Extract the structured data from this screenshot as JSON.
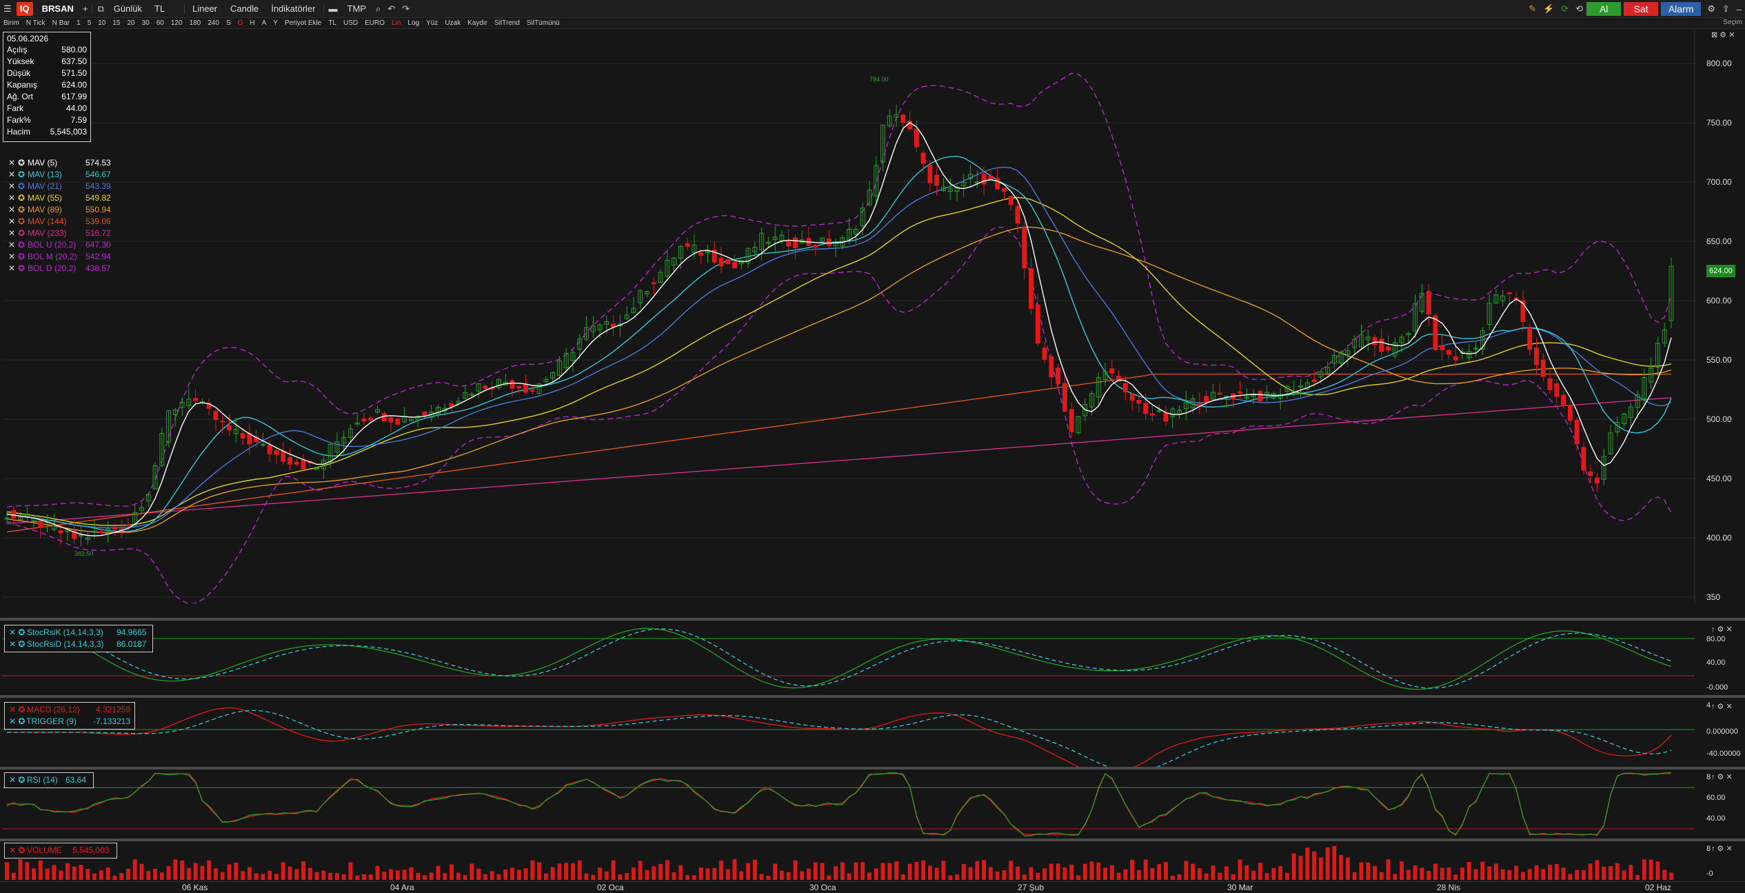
{
  "toolbar": {
    "symbol": "BRSAN",
    "plus": "+",
    "period": "Günlük",
    "currency": "TL",
    "scale": "Lineer",
    "chart_type": "Candle",
    "indicators": "İndikatörler",
    "tmp": "TMP",
    "buy": "Al",
    "sell": "Sat",
    "alarm": "Alarm"
  },
  "toolbar2": {
    "items": [
      "Birim",
      "N Tick",
      "N Bar",
      "1",
      "5",
      "10",
      "15",
      "20",
      "30",
      "60",
      "120",
      "180",
      "240",
      "S",
      "G",
      "H",
      "A",
      "Y",
      "Periyot Ekle",
      "TL",
      "USD",
      "EURO",
      "Lin",
      "Log",
      "Yüz",
      "Uzak",
      "Kaydır",
      "SilTrend",
      "SilTümünü"
    ],
    "active": [
      "G",
      "Lin"
    ],
    "right": "Seçim"
  },
  "info": {
    "date": "05.06.2026",
    "rows": [
      {
        "label": "Açılış",
        "value": "580.00"
      },
      {
        "label": "Yüksek",
        "value": "637.50"
      },
      {
        "label": "Düşük",
        "value": "571.50"
      },
      {
        "label": "Kapanış",
        "value": "624.00"
      },
      {
        "label": "Ağ. Ort",
        "value": "617.99"
      },
      {
        "label": "Fark",
        "value": "44.00"
      },
      {
        "label": "Fark%",
        "value": "7.59"
      },
      {
        "label": "Hacim",
        "value": "5,545,003"
      }
    ]
  },
  "legend": [
    {
      "name": "MAV (5)",
      "value": "574.53",
      "color": "#ffffff"
    },
    {
      "name": "MAV (13)",
      "value": "546.67",
      "color": "#33c6d6"
    },
    {
      "name": "MAV (21)",
      "value": "543.39",
      "color": "#4a78d8"
    },
    {
      "name": "MAV (55)",
      "value": "549.82",
      "color": "#e0d026"
    },
    {
      "name": "MAV (89)",
      "value": "550.94",
      "color": "#e09a26"
    },
    {
      "name": "MAV (144)",
      "value": "539.06",
      "color": "#d8531e"
    },
    {
      "name": "MAV (233)",
      "value": "516.72",
      "color": "#cf2f8c"
    },
    {
      "name": "BOL U (20,2)",
      "value": "647.30",
      "color": "#b526c8"
    },
    {
      "name": "BOL M (20,2)",
      "value": "542.94",
      "color": "#b526c8"
    },
    {
      "name": "BOL D (20,2)",
      "value": "438.57",
      "color": "#b526c8"
    }
  ],
  "price_axis": [
    "800.00",
    "750.00",
    "700.00",
    "650.00",
    "600.00",
    "550.00",
    "500.00",
    "450.00",
    "400.00",
    "350"
  ],
  "last_price": "624.00",
  "annotations": {
    "high": "784.00",
    "low": "383.50"
  },
  "stoch": {
    "k_name": "StocRsiK (14,14,3,3)",
    "k_value": "94.9665",
    "d_name": "StocRsiD (14,14,3,3)",
    "d_value": "86.0187",
    "axis": [
      "80.00",
      "40.00",
      "-0.000"
    ]
  },
  "macd": {
    "macd_name": "MACD (26,12)",
    "macd_value": "4.321259",
    "trig_name": "TRIGGER (9)",
    "trig_value": "-7.133213",
    "axis": [
      "4",
      "0.000000",
      "-40.00000"
    ]
  },
  "rsi": {
    "name": "RSI (14)",
    "value": "63.64",
    "axis": [
      "8",
      "60.00",
      "40.00"
    ]
  },
  "volume": {
    "name": "VOLUME",
    "value": "5,545,003",
    "axis": [
      "8",
      "-0"
    ]
  },
  "date_axis": [
    "06 Kas",
    "04 Ara",
    "02 Oca",
    "30 Oca",
    "27 Şub",
    "30 Mar",
    "28 Nis",
    "02 Haz"
  ],
  "colors": {
    "up": "#22a022",
    "down": "#e01a1a",
    "accent": "#e8311a"
  }
}
